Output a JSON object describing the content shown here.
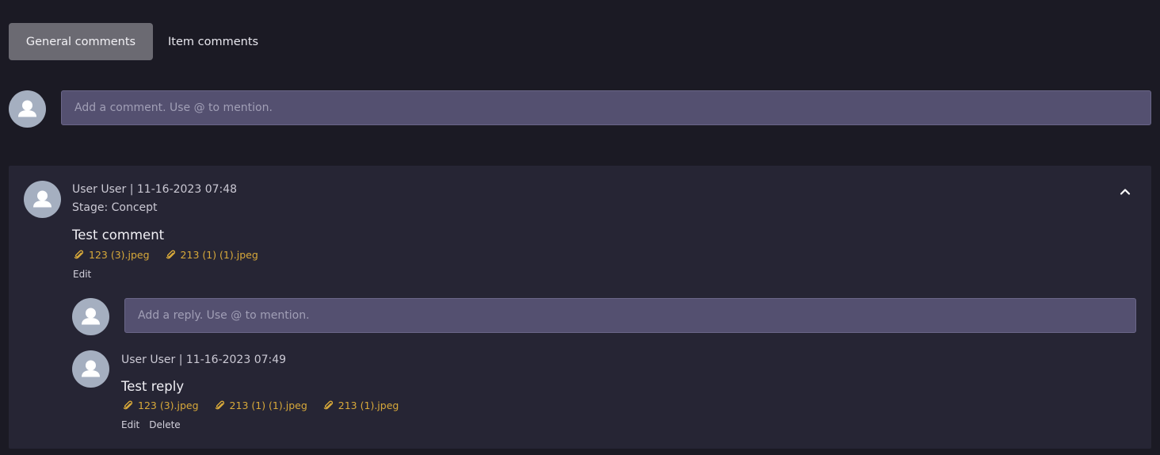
{
  "tabs": [
    {
      "label": "General comments",
      "active": true
    },
    {
      "label": "Item comments",
      "active": false
    }
  ],
  "new_comment": {
    "placeholder": "Add a comment. Use @ to mention."
  },
  "comment": {
    "meta": "User User | 11-16-2023 07:48",
    "stage": "Stage: Concept",
    "text": "Test comment",
    "attachments": [
      "123 (3).jpeg",
      "213 (1) (1).jpeg"
    ],
    "actions": {
      "edit": "Edit"
    },
    "reply_input": {
      "placeholder": "Add a reply. Use @ to mention."
    },
    "reply": {
      "meta": "User User | 11-16-2023 07:49",
      "text": "Test reply",
      "attachments": [
        "123 (3).jpeg",
        "213 (1) (1).jpeg",
        "213 (1).jpeg"
      ],
      "actions": {
        "edit": "Edit",
        "delete": "Delete"
      }
    }
  },
  "icons": {
    "avatar": "user-avatar-icon",
    "attachment": "paperclip-icon",
    "collapse": "chevron-up-icon"
  },
  "colors": {
    "background": "#1b1a24",
    "card": "#262534",
    "input": "#545070",
    "active_tab": "#6b6a72",
    "attachment": "#d8a93a"
  }
}
